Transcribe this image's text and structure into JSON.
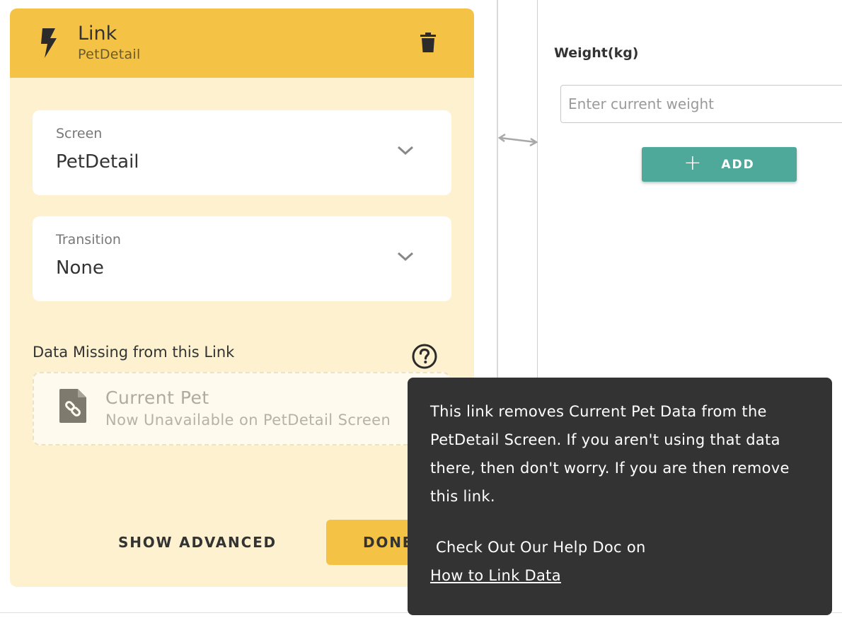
{
  "link_panel": {
    "title": "Link",
    "subtitle": "PetDetail",
    "screen_select": {
      "label": "Screen",
      "value": "PetDetail"
    },
    "transition_select": {
      "label": "Transition",
      "value": "None"
    },
    "missing_data": {
      "title": "Data Missing from this Link",
      "item_name": "Current Pet",
      "item_description": "Now Unavailable on PetDetail Screen"
    },
    "show_advanced_label": "SHOW ADVANCED",
    "done_label": "DONE"
  },
  "preview": {
    "weight_label": "Weight(kg)",
    "weight_placeholder": "Enter current weight",
    "add_button_label": "ADD"
  },
  "tooltip": {
    "message": "This link removes Current Pet Data from the PetDetail Screen. If you aren't using that data there, then don't worry. If you are then remove this link.",
    "cta": "Check Out Our Help Doc on",
    "link_text": "How to Link Data"
  },
  "colors": {
    "header_yellow": "#f4c245",
    "panel_bg": "#fdf1cf",
    "add_button_teal": "#4ea99b",
    "tooltip_bg": "#333333"
  },
  "icons": {
    "header": "lightning-bolt-icon",
    "delete": "trash-icon",
    "dropdown": "chevron-down-icon",
    "help": "question-circle-icon",
    "missing_item": "linked-document-icon",
    "add": "plus-icon"
  }
}
